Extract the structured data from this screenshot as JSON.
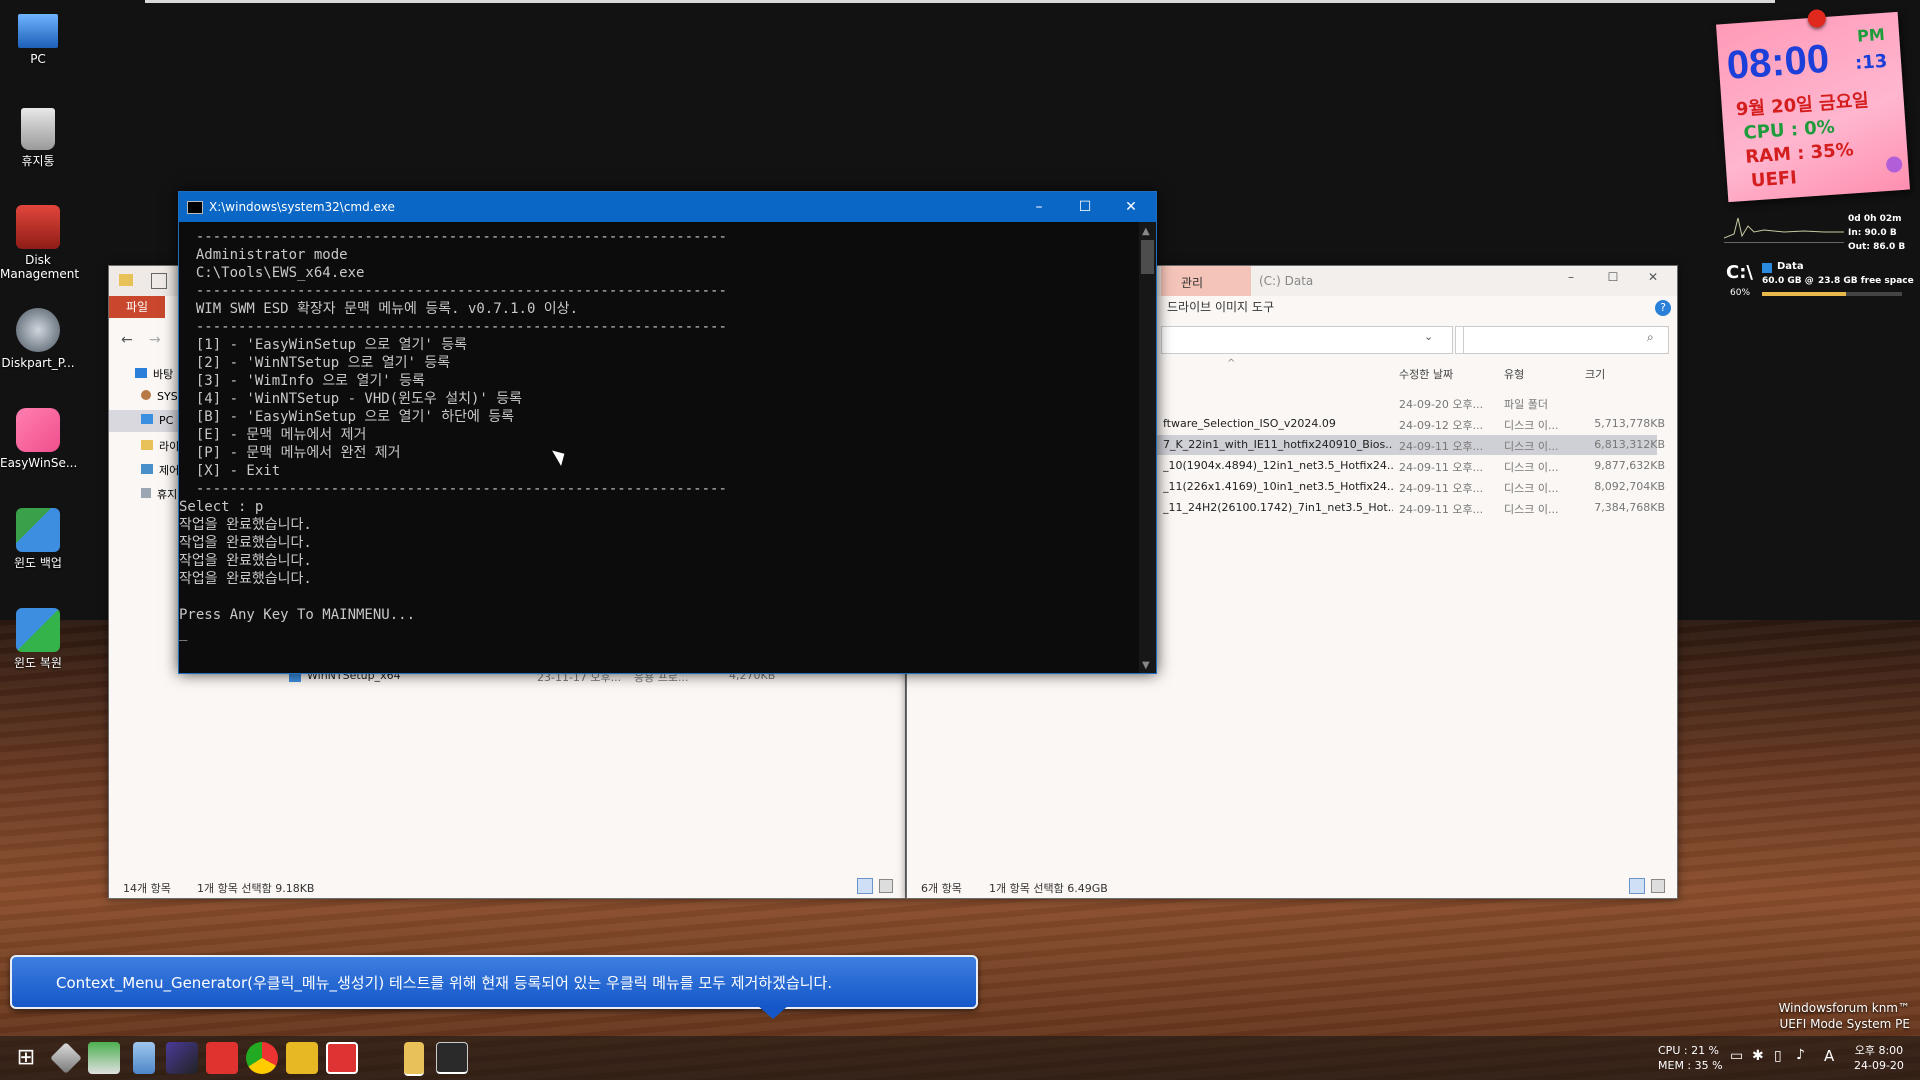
{
  "desktop": {
    "icons": [
      {
        "label": "PC"
      },
      {
        "label": "휴지통"
      },
      {
        "label": "Disk Management"
      },
      {
        "label": "Diskpart_P..."
      },
      {
        "label": "EasyWinSe..."
      },
      {
        "label": "윈도 백업"
      },
      {
        "label": "윈도 복원"
      }
    ],
    "watermark_line1": "Windowsforum knm™",
    "watermark_line2": "UEFI Mode System PE"
  },
  "widget": {
    "time": "08:00",
    "ampm": "PM",
    "seconds": ":13",
    "date": "9월 20일 금요일",
    "cpu": "CPU :  0%",
    "ram": "RAM : 35%",
    "mode": "UEFI",
    "uptime": "0d 0h 02m",
    "net_in": "In: 90.0 B",
    "net_out": "Out: 86.0 B",
    "drive": "C:\\",
    "drive_pct": "60%",
    "data_label": "Data",
    "data_size": "60.0 GB @",
    "free_space": "23.8 GB free space",
    "drive_used_fraction": 0.6
  },
  "explorer_left": {
    "ribbon_file": "파일",
    "tree": [
      "바탕",
      "SYS",
      "PC",
      "라이",
      "제어",
      "휴지"
    ],
    "visible_row": {
      "name": "WinNTSetup_x64",
      "date": "23-11-17 오후...",
      "type": "응용 프로...",
      "size": "4,270KB"
    },
    "status_count": "14개 항목",
    "status_selected": "1개 항목 선택함 9.18KB"
  },
  "explorer_right": {
    "tab_manage": "관리",
    "title": "(C:) Data",
    "ribbon_image_tools": "드라이브 이미지 도구",
    "columns": {
      "date": "수정한 날짜",
      "type": "유형",
      "size": "크기"
    },
    "rows": [
      {
        "name": "",
        "date": "24-09-20 오후...",
        "type": "파일 폴더",
        "size": ""
      },
      {
        "name": "ftware_Selection_ISO_v2024.09",
        "date": "24-09-12 오후...",
        "type": "디스크 이...",
        "size": "5,713,778KB"
      },
      {
        "name": "7_K_22in1_with_IE11_hotfix240910_Bios...",
        "date": "24-09-11 오후...",
        "type": "디스크 이...",
        "size": "6,813,312KB"
      },
      {
        "name": "_10(1904x.4894)_12in1_net3.5_Hotfix24...",
        "date": "24-09-11 오후...",
        "type": "디스크 이...",
        "size": "9,877,632KB"
      },
      {
        "name": "_11(226x1.4169)_10in1_net3.5_Hotfix24...",
        "date": "24-09-11 오후...",
        "type": "디스크 이...",
        "size": "8,092,704KB"
      },
      {
        "name": "_11_24H2(26100.1742)_7in1_net3.5_Hot...",
        "date": "24-09-11 오후...",
        "type": "디스크 이...",
        "size": "7,384,768KB"
      }
    ],
    "status_count": "6개 항목",
    "status_selected": "1개 항목 선택함 6.49GB"
  },
  "cmd": {
    "title": "X:\\windows\\system32\\cmd.exe",
    "lines": [
      "  ---------------------------------------------------------------",
      "  Administrator mode",
      "  C:\\Tools\\EWS_x64.exe",
      "  ---------------------------------------------------------------",
      "  WIM SWM ESD 확장자 문맥 메뉴에 등록. v0.7.1.0 이상.",
      "  ---------------------------------------------------------------",
      "  [1] - 'EasyWinSetup 으로 열기' 등록",
      "  [2] - 'WinNTSetup 으로 열기' 등록",
      "  [3] - 'WimInfo 으로 열기' 등록",
      "  [4] - 'WinNTSetup - VHD(윈도우 설치)' 등록",
      "  [B] - 'EasyWinSetup 으로 열기' 하단에 등록",
      "  [E] - 문맥 메뉴에서 제거",
      "  [P] - 문맥 메뉴에서 완전 제거",
      "  [X] - Exit",
      "  ---------------------------------------------------------------",
      "Select : p",
      "작업을 완료했습니다.",
      "작업을 완료했습니다.",
      "작업을 완료했습니다.",
      "작업을 완료했습니다.",
      "",
      "Press Any Key To MAINMENU...",
      "_"
    ]
  },
  "notification": {
    "text": "Context_Menu_Generator(우클릭_메뉴_생성기) 테스트를 위해 현재 등록되어 있는 우클릭 메뉴를 모두 제거하겠습니다."
  },
  "taskbar": {
    "cpu": "CPU : 21 %",
    "mem": "MEM : 35 %",
    "ime": "A",
    "time": "오후 8:00",
    "date": "24-09-20"
  }
}
